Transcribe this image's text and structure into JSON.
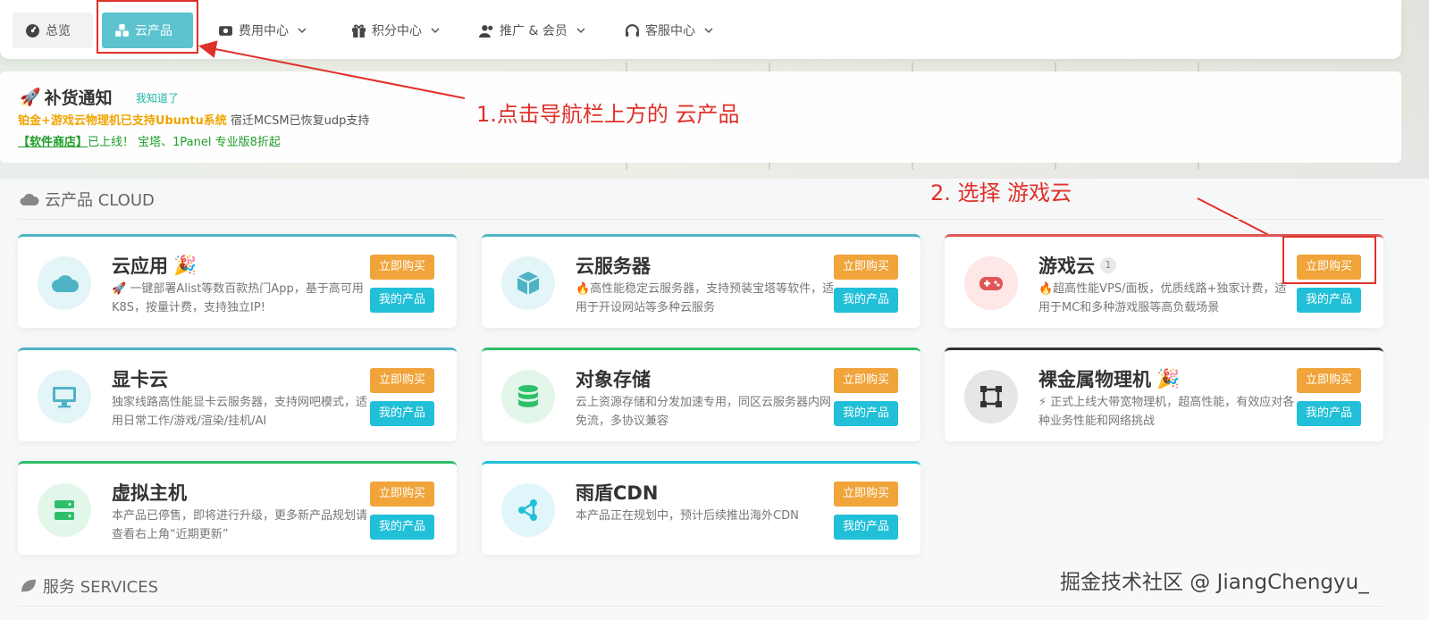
{
  "nav": {
    "items": [
      {
        "label": "总览",
        "icon": "dashboard-icon"
      },
      {
        "label": "云产品",
        "icon": "cubes-icon",
        "active": true
      },
      {
        "label": "费用中心",
        "icon": "money-icon",
        "dropdown": true
      },
      {
        "label": "积分中心",
        "icon": "gift-icon",
        "dropdown": true
      },
      {
        "label": "推广 & 会员",
        "icon": "users-icon",
        "dropdown": true
      },
      {
        "label": "客服中心",
        "icon": "headset-icon",
        "dropdown": true
      }
    ],
    "active_color": "#5cc3cf"
  },
  "notice": {
    "emoji": "🚀",
    "title": "补货通知",
    "dismiss_label": "我知道了",
    "line1_highlight": "铂金+游戏云物理机已支持Ubuntu系统",
    "line1_rest": " 宿迁MCSM已恢复udp支持",
    "line2_store": "【软件商店】",
    "line2_rest": "已上线！ 宝塔、1Panel 专业版8折起"
  },
  "annotations": {
    "step1": "1.点击导航栏上方的  云产品",
    "step2": "2. 选择  游戏云",
    "color": "#e0302a"
  },
  "sections": {
    "cloud_title": "云产品 CLOUD",
    "services_title": "服务 SERVICES"
  },
  "buttons": {
    "buy": "立即购买",
    "mine": "我的产品"
  },
  "cards": [
    {
      "title": "云应用",
      "emoji": "🎉",
      "desc": "🚀 一键部署Alist等数百款热门App，基于高可用K8S，按量计费，支持独立IP!",
      "icon": "cloud-icon",
      "accent": "#4fb3c6"
    },
    {
      "title": "云服务器",
      "emoji": "",
      "desc": "🔥高性能稳定云服务器，支持预装宝塔等软件，适用于开设网站等多种云服务",
      "icon": "box-icon",
      "accent": "#4fb3c6"
    },
    {
      "title": "游戏云",
      "badge": "1",
      "desc": "🔥超高性能VPS/面板，优质线路+独家计费，适用于MC和多种游戏服等高负载场景",
      "icon": "gamepad-icon",
      "accent": "#e05555"
    },
    {
      "title": "显卡云",
      "emoji": "",
      "desc": "独家线路高性能显卡云服务器，支持网吧模式，适用日常工作/游戏/渲染/挂机/AI",
      "icon": "monitor-icon",
      "accent": "#4fb3c6"
    },
    {
      "title": "对象存储",
      "emoji": "",
      "desc": "云上资源存储和分发加速专用，同区云服务器内网免流，多协议兼容",
      "icon": "database-icon",
      "accent": "#2fbf6a"
    },
    {
      "title": "裸金属物理机",
      "emoji": "🎉",
      "desc": "⚡ 正式上线大带宽物理机，超高性能，有效应对各种业务性能和网络挑战",
      "icon": "vector-square-icon",
      "accent": "#333333"
    },
    {
      "title": "虚拟主机",
      "emoji": "",
      "desc": "本产品已停售，即将进行升级，更多新产品规划请查看右上角“近期更新”",
      "icon": "server-icon",
      "accent": "#2fbf6a"
    },
    {
      "title": "雨盾CDN",
      "emoji": "",
      "desc": "本产品正在规划中，预计后续推出海外CDN",
      "icon": "share-nodes-icon",
      "accent": "#21c0d8"
    }
  ],
  "watermark": "掘金技术社区 @ JiangChengyu_"
}
